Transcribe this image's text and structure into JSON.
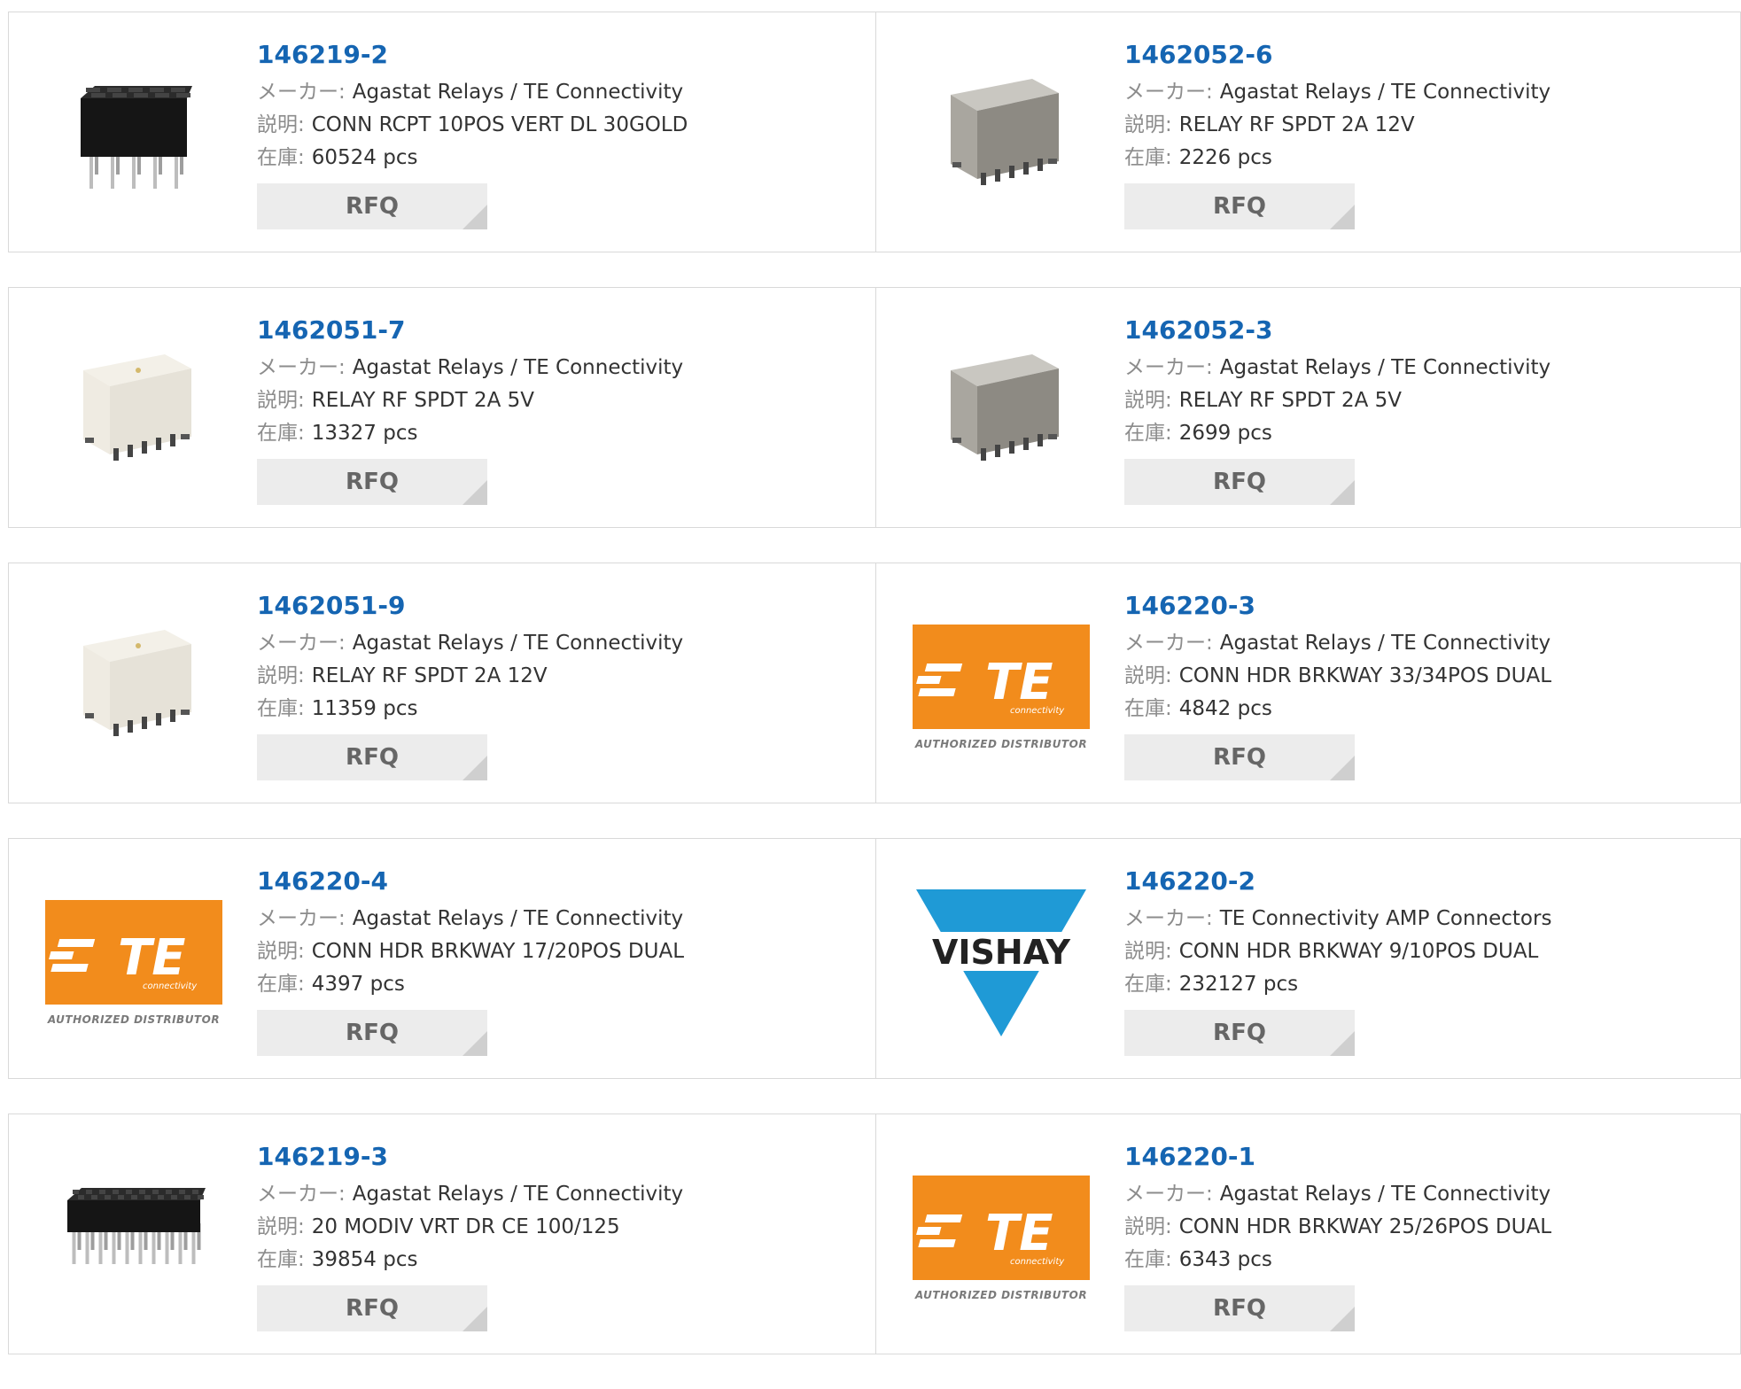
{
  "labels": {
    "maker": "メーカー:",
    "desc": "説明:",
    "stock": "在庫:",
    "rfq": "RFQ"
  },
  "products": [
    {
      "part": "146219-2",
      "maker": "Agastat Relays / TE Connectivity",
      "desc": "CONN RCPT 10POS VERT DL 30GOLD",
      "stock": "60524 pcs",
      "image": "header-connector-2x5"
    },
    {
      "part": "1462052-6",
      "maker": "Agastat Relays / TE Connectivity",
      "desc": "RELAY RF SPDT 2A 12V",
      "stock": "2226 pcs",
      "image": "relay-metal"
    },
    {
      "part": "1462051-7",
      "maker": "Agastat Relays / TE Connectivity",
      "desc": "RELAY RF SPDT 2A 5V",
      "stock": "13327 pcs",
      "image": "relay-white"
    },
    {
      "part": "1462052-3",
      "maker": "Agastat Relays / TE Connectivity",
      "desc": "RELAY RF SPDT 2A 5V",
      "stock": "2699 pcs",
      "image": "relay-metal"
    },
    {
      "part": "1462051-9",
      "maker": "Agastat Relays / TE Connectivity",
      "desc": "RELAY RF SPDT 2A 12V",
      "stock": "11359 pcs",
      "image": "relay-white"
    },
    {
      "part": "146220-3",
      "maker": "Agastat Relays / TE Connectivity",
      "desc": "CONN HDR BRKWAY 33/34POS DUAL",
      "stock": "4842 pcs",
      "image": "te-logo"
    },
    {
      "part": "146220-4",
      "maker": "Agastat Relays / TE Connectivity",
      "desc": "CONN HDR BRKWAY 17/20POS DUAL",
      "stock": "4397 pcs",
      "image": "te-logo"
    },
    {
      "part": "146220-2",
      "maker": "TE Connectivity AMP Connectors",
      "desc": "CONN HDR BRKWAY 9/10POS DUAL",
      "stock": "232127 pcs",
      "image": "vishay-logo"
    },
    {
      "part": "146219-3",
      "maker": "Agastat Relays / TE Connectivity",
      "desc": "20 MODIV VRT DR CE 100/125",
      "stock": "39854 pcs",
      "image": "header-connector-2x10"
    },
    {
      "part": "146220-1",
      "maker": "Agastat Relays / TE Connectivity",
      "desc": "CONN HDR BRKWAY 25/26POS DUAL",
      "stock": "6343 pcs",
      "image": "te-logo"
    }
  ],
  "logos": {
    "te": {
      "text": "TE",
      "sub": "connectivity",
      "tagline": "AUTHORIZED DISTRIBUTOR"
    },
    "vishay": {
      "text": "VISHAY"
    }
  },
  "colors": {
    "link": "#1565b2",
    "label": "#8c8c8c",
    "te_orange": "#f28c1c",
    "vishay_blue": "#1f9ad6",
    "rfq_bg": "#ececec"
  }
}
